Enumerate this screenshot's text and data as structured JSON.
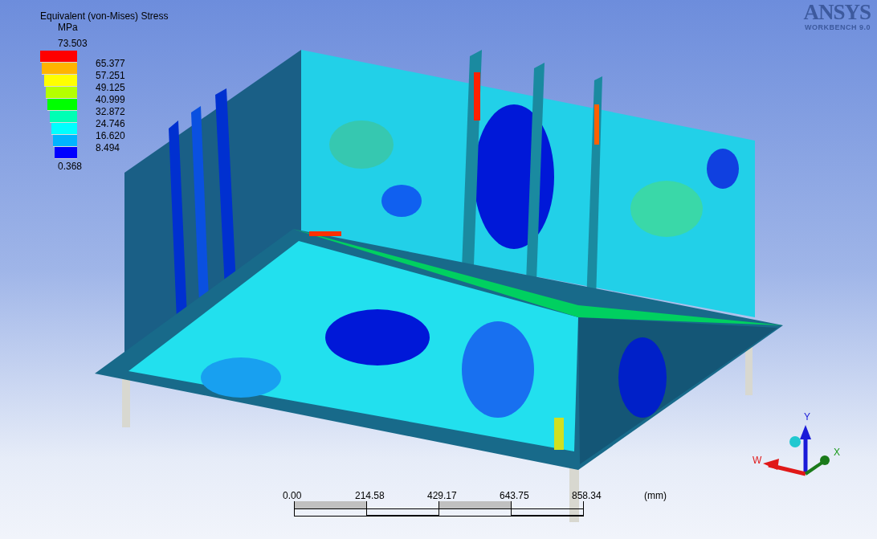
{
  "legend": {
    "title": "Equivalent (von-Mises) Stress",
    "unit": "MPa",
    "max": "73.503",
    "min": "0.368",
    "bands": [
      {
        "color": "#ff0000",
        "label": "65.377"
      },
      {
        "color": "#ffb400",
        "label": "57.251"
      },
      {
        "color": "#ffff00",
        "label": "49.125"
      },
      {
        "color": "#b4ff00",
        "label": "40.999"
      },
      {
        "color": "#00ff00",
        "label": "32.872"
      },
      {
        "color": "#00ffb4",
        "label": "24.746"
      },
      {
        "color": "#00ffff",
        "label": "16.620"
      },
      {
        "color": "#00b4ff",
        "label": "8.494"
      },
      {
        "color": "#0000ff"
      }
    ]
  },
  "logo": {
    "brand": "ANSYS",
    "product": "WORKBENCH 9.0"
  },
  "triad": {
    "y_label": "Y",
    "x_label": "X",
    "w_label": "W"
  },
  "scale_bar": {
    "ticks": [
      "0.00",
      "214.58",
      "429.17",
      "643.75",
      "858.34"
    ],
    "unit": "(mm)"
  }
}
